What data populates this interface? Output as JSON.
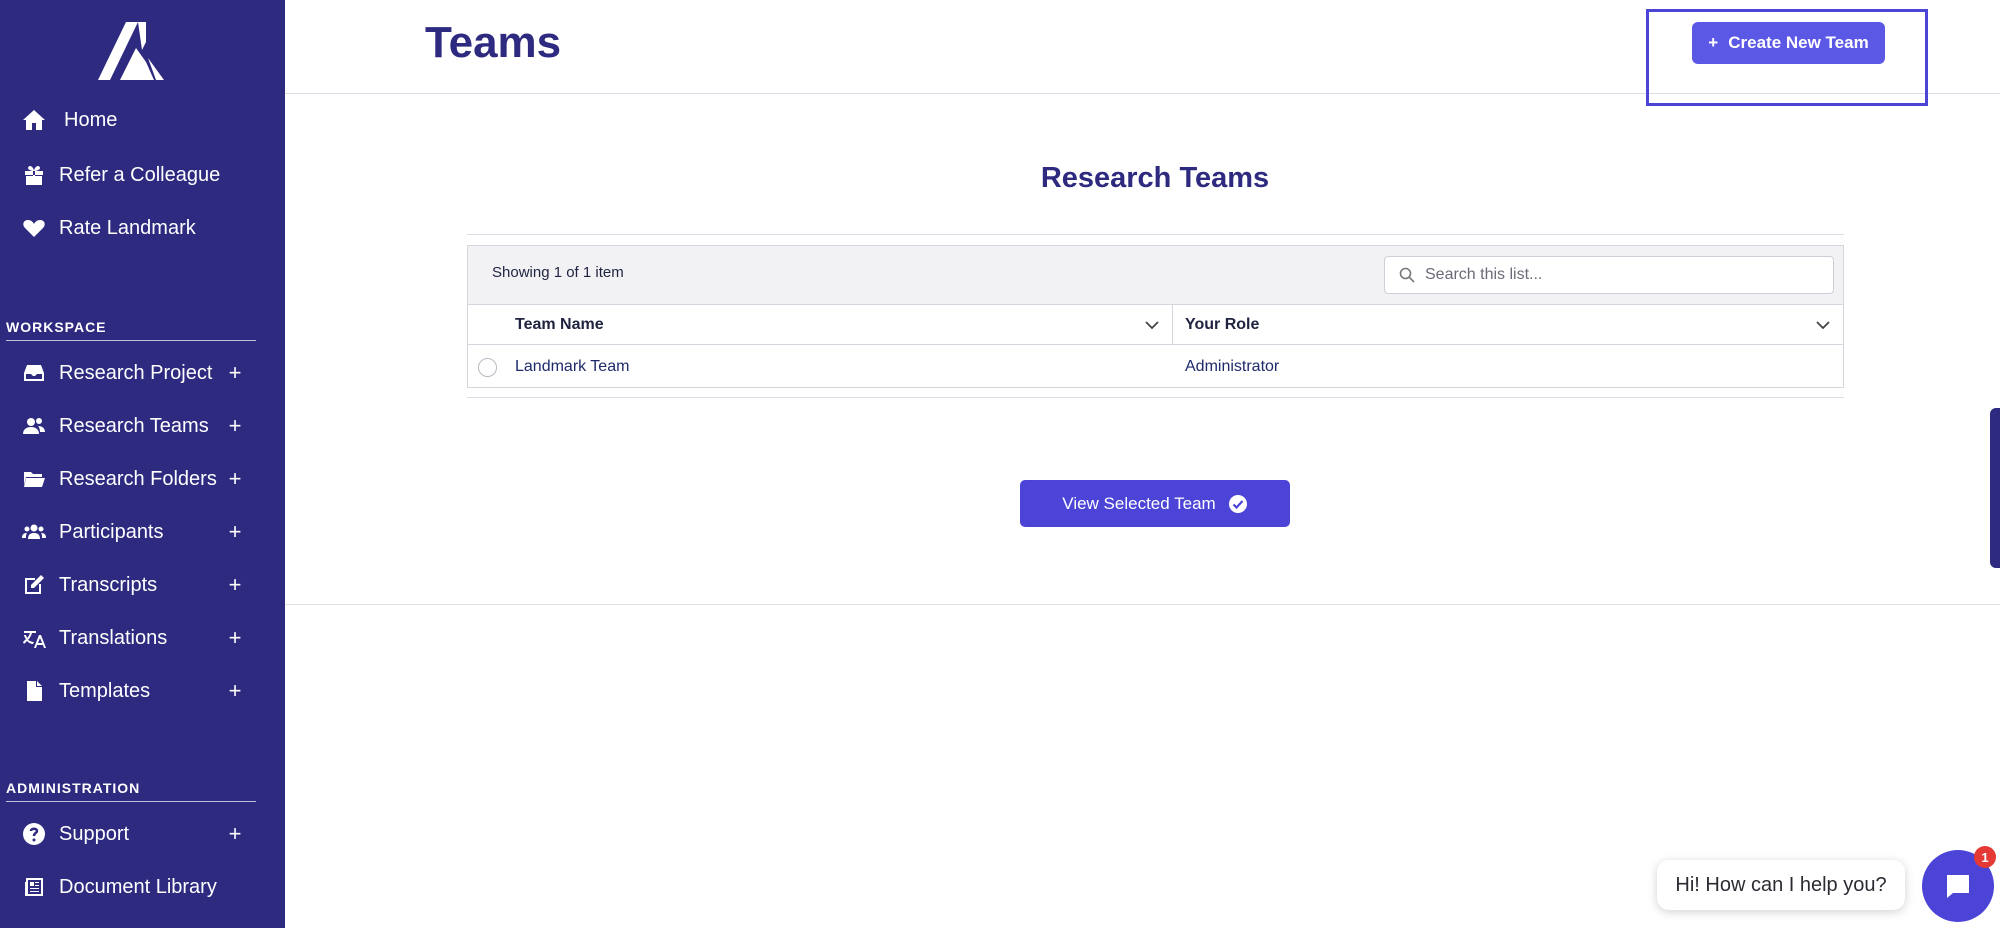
{
  "sidebar": {
    "top_items": [
      {
        "label": "Home",
        "icon": "home-icon"
      },
      {
        "label": "Refer a Colleague",
        "icon": "gift-icon"
      },
      {
        "label": "Rate Landmark",
        "icon": "heart-icon"
      }
    ],
    "workspace_title": "WORKSPACE",
    "workspace_items": [
      {
        "label": "Research Project",
        "icon": "inbox-icon",
        "plus": "+"
      },
      {
        "label": "Research Teams",
        "icon": "users-icon",
        "plus": "+"
      },
      {
        "label": "Research Folders",
        "icon": "folder-icon",
        "plus": "+"
      },
      {
        "label": "Participants",
        "icon": "group-icon",
        "plus": "+"
      },
      {
        "label": "Transcripts",
        "icon": "edit-icon",
        "plus": "+"
      },
      {
        "label": "Translations",
        "icon": "translate-icon",
        "plus": "+"
      },
      {
        "label": "Templates",
        "icon": "file-icon",
        "plus": "+"
      }
    ],
    "admin_title": "ADMINISTRATION",
    "admin_items": [
      {
        "label": "Support",
        "icon": "question-icon",
        "plus": "+"
      },
      {
        "label": "Document Library",
        "icon": "newspaper-icon"
      }
    ]
  },
  "header": {
    "title": "Teams",
    "create_button": "Create New Team",
    "create_plus": "+"
  },
  "main": {
    "heading": "Research Teams",
    "showing": "Showing 1 of 1 item",
    "search_placeholder": "Search this list...",
    "columns": [
      "Team Name",
      "Your Role"
    ],
    "rows": [
      {
        "team_name": "Landmark Team",
        "role": "Administrator"
      }
    ],
    "view_button": "View Selected Team"
  },
  "chat": {
    "message": "Hi! How can I help you?",
    "badge": "1"
  },
  "colors": {
    "sidebar": "#2d2a7f",
    "accent": "#4b44d6",
    "create_button": "#5c58e6",
    "badge": "#e53935"
  }
}
